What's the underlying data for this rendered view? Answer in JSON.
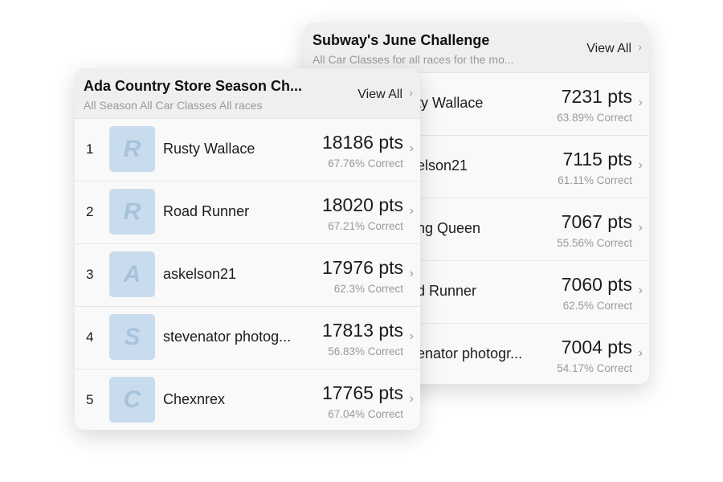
{
  "back_card": {
    "title": "Subway's June Challenge",
    "subtitle": "All Car Classes for all races for the mo...",
    "view_all": "View All",
    "rows": [
      {
        "name": "ty Wallace",
        "points": "7231 pts",
        "correct": "63.89% Correct"
      },
      {
        "name": "elson21",
        "points": "7115 pts",
        "correct": "61.11% Correct"
      },
      {
        "name": "ng Queen",
        "points": "7067 pts",
        "correct": "55.56% Correct"
      },
      {
        "name": "d Runner",
        "points": "7060 pts",
        "correct": "62.5% Correct"
      },
      {
        "name": "enator photogr...",
        "points": "7004 pts",
        "correct": "54.17% Correct"
      }
    ]
  },
  "front_card": {
    "title": "Ada Country Store Season Ch...",
    "subtitle": "All Season All Car Classes All races",
    "view_all": "View All",
    "rows": [
      {
        "rank": "1",
        "initial": "R",
        "name": "Rusty Wallace",
        "points": "18186 pts",
        "correct": "67.76% Correct"
      },
      {
        "rank": "2",
        "initial": "R",
        "name": "Road Runner",
        "points": "18020 pts",
        "correct": "67.21% Correct"
      },
      {
        "rank": "3",
        "initial": "A",
        "name": "askelson21",
        "points": "17976 pts",
        "correct": "62.3% Correct"
      },
      {
        "rank": "4",
        "initial": "S",
        "name": "stevenator photog...",
        "points": "17813 pts",
        "correct": "56.83% Correct"
      },
      {
        "rank": "5",
        "initial": "C",
        "name": "Chexnrex",
        "points": "17765 pts",
        "correct": "67.04% Correct"
      }
    ]
  },
  "icons": {
    "chevron": "›"
  }
}
